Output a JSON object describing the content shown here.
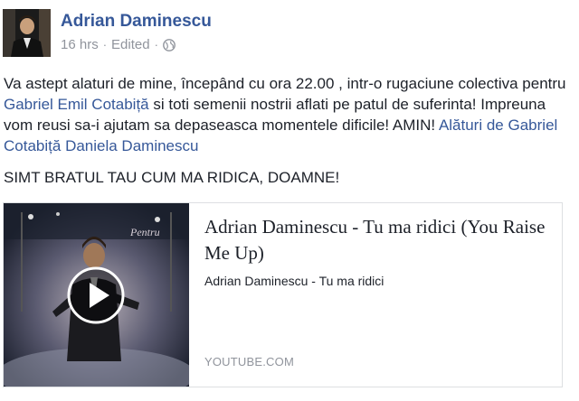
{
  "post": {
    "author": "Adrian Daminescu",
    "time": "16 hrs",
    "separator": "·",
    "edited": "Edited",
    "separator2": "·",
    "body": {
      "part1": "Va astept alaturi de mine, începând cu ora 22.00 , intr-o rugaciune colectiva pentru ",
      "tag1": "Gabriel Emil Cotabiță",
      "part2": " si toti semenii nostrii aflati pe patul de suferinta! Impreuna vom reusi sa-i ajutam sa depaseasca momentele dificile! AMIN! ",
      "with_label": "Alături de",
      "tag2": "Gabriel Cotabiță",
      "tag3": "Daniela Daminescu",
      "line2": "SIMT BRATUL TAU CUM MA RIDICA, DOAMNE!"
    },
    "link_card": {
      "title": "Adrian Daminescu - Tu ma ridici (You Raise Me Up)",
      "description": "Adrian Daminescu - Tu ma ridici",
      "source": "YOUTUBE.COM",
      "thumbnail_overlay_text": "Pentru"
    }
  },
  "icons": {
    "globe": "globe-icon",
    "play": "play-icon"
  },
  "colors": {
    "link": "#365899",
    "text": "#1d2129",
    "meta": "#90949c",
    "border": "#dddfe2"
  }
}
